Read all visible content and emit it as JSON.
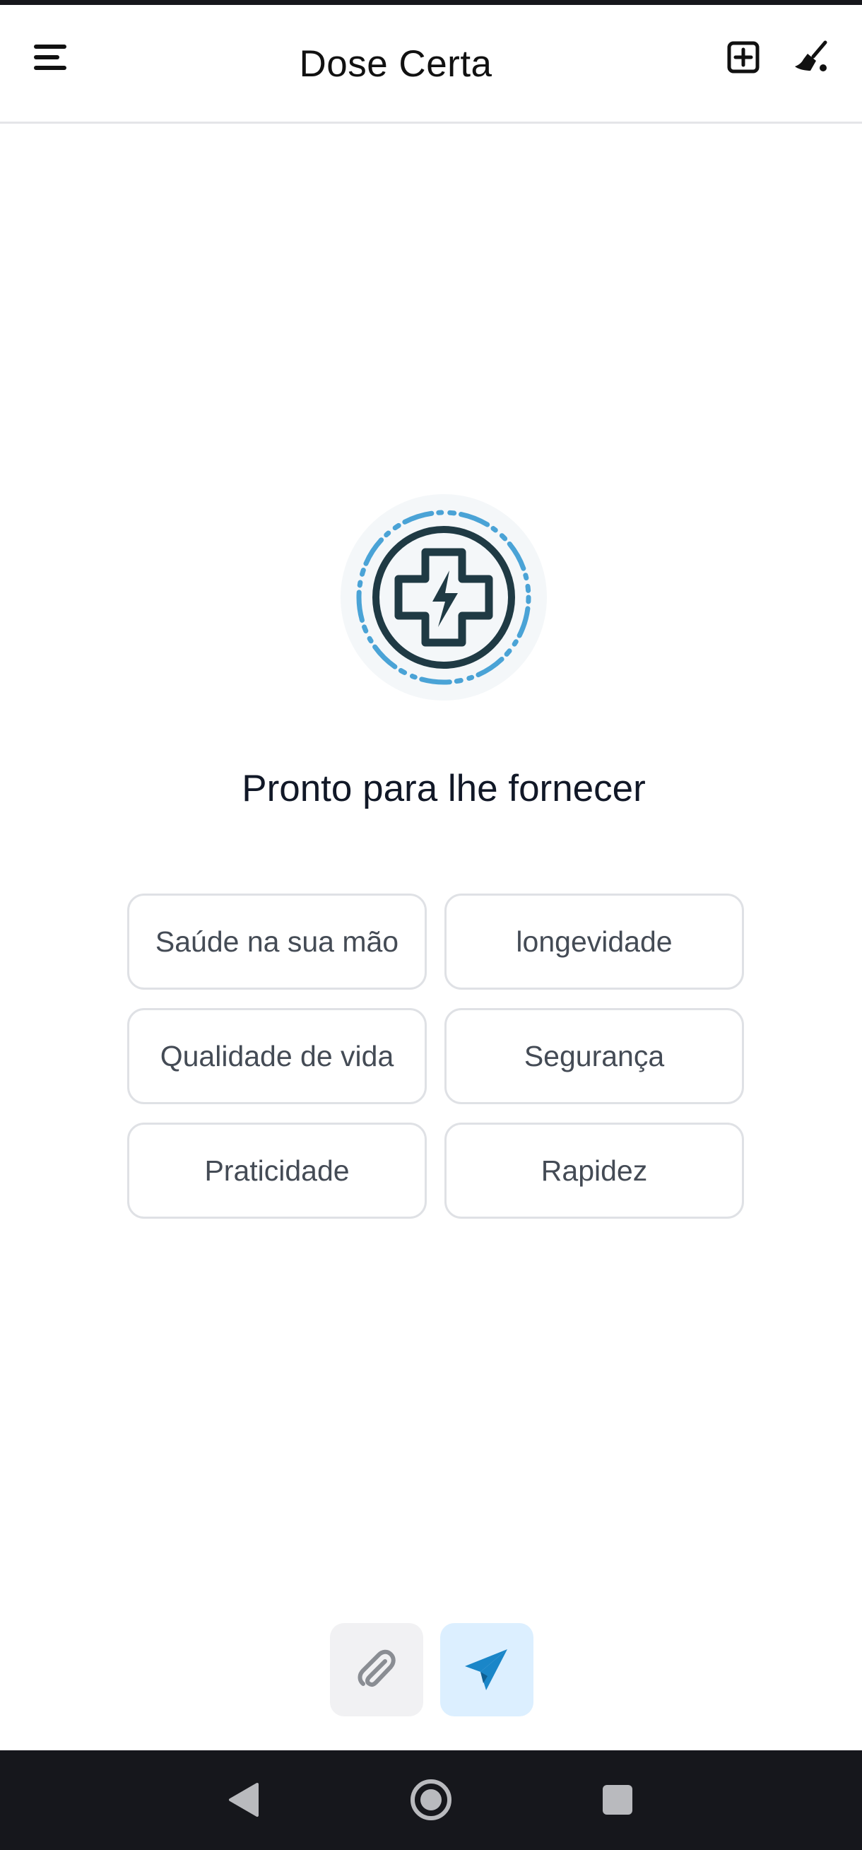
{
  "app": {
    "title": "Dose Certa"
  },
  "header": {
    "menu_icon": "hamburger-menu-icon",
    "new_chat_icon": "plus-square-icon",
    "clear_icon": "broom-icon"
  },
  "main": {
    "logo_icon": "medical-cross-bolt-icon",
    "headline": "Pronto para lhe fornecer",
    "suggestions": [
      "Saúde na sua mão",
      "longevidade",
      "Qualidade de vida",
      "Segurança",
      "Praticidade",
      "Rapidez"
    ]
  },
  "composer": {
    "attach_icon": "paperclip-icon",
    "send_icon": "paper-plane-icon"
  },
  "system_nav": {
    "back_icon": "triangle-back-icon",
    "home_icon": "circle-home-icon",
    "recents_icon": "square-recents-icon"
  },
  "colors": {
    "accent": "#1a86c8",
    "logo_dark": "#1f3a44",
    "logo_light": "#4aa3d6",
    "nav_bg": "#16171c",
    "chip_border": "#dfe1e5",
    "send_bg": "#dcefff"
  }
}
